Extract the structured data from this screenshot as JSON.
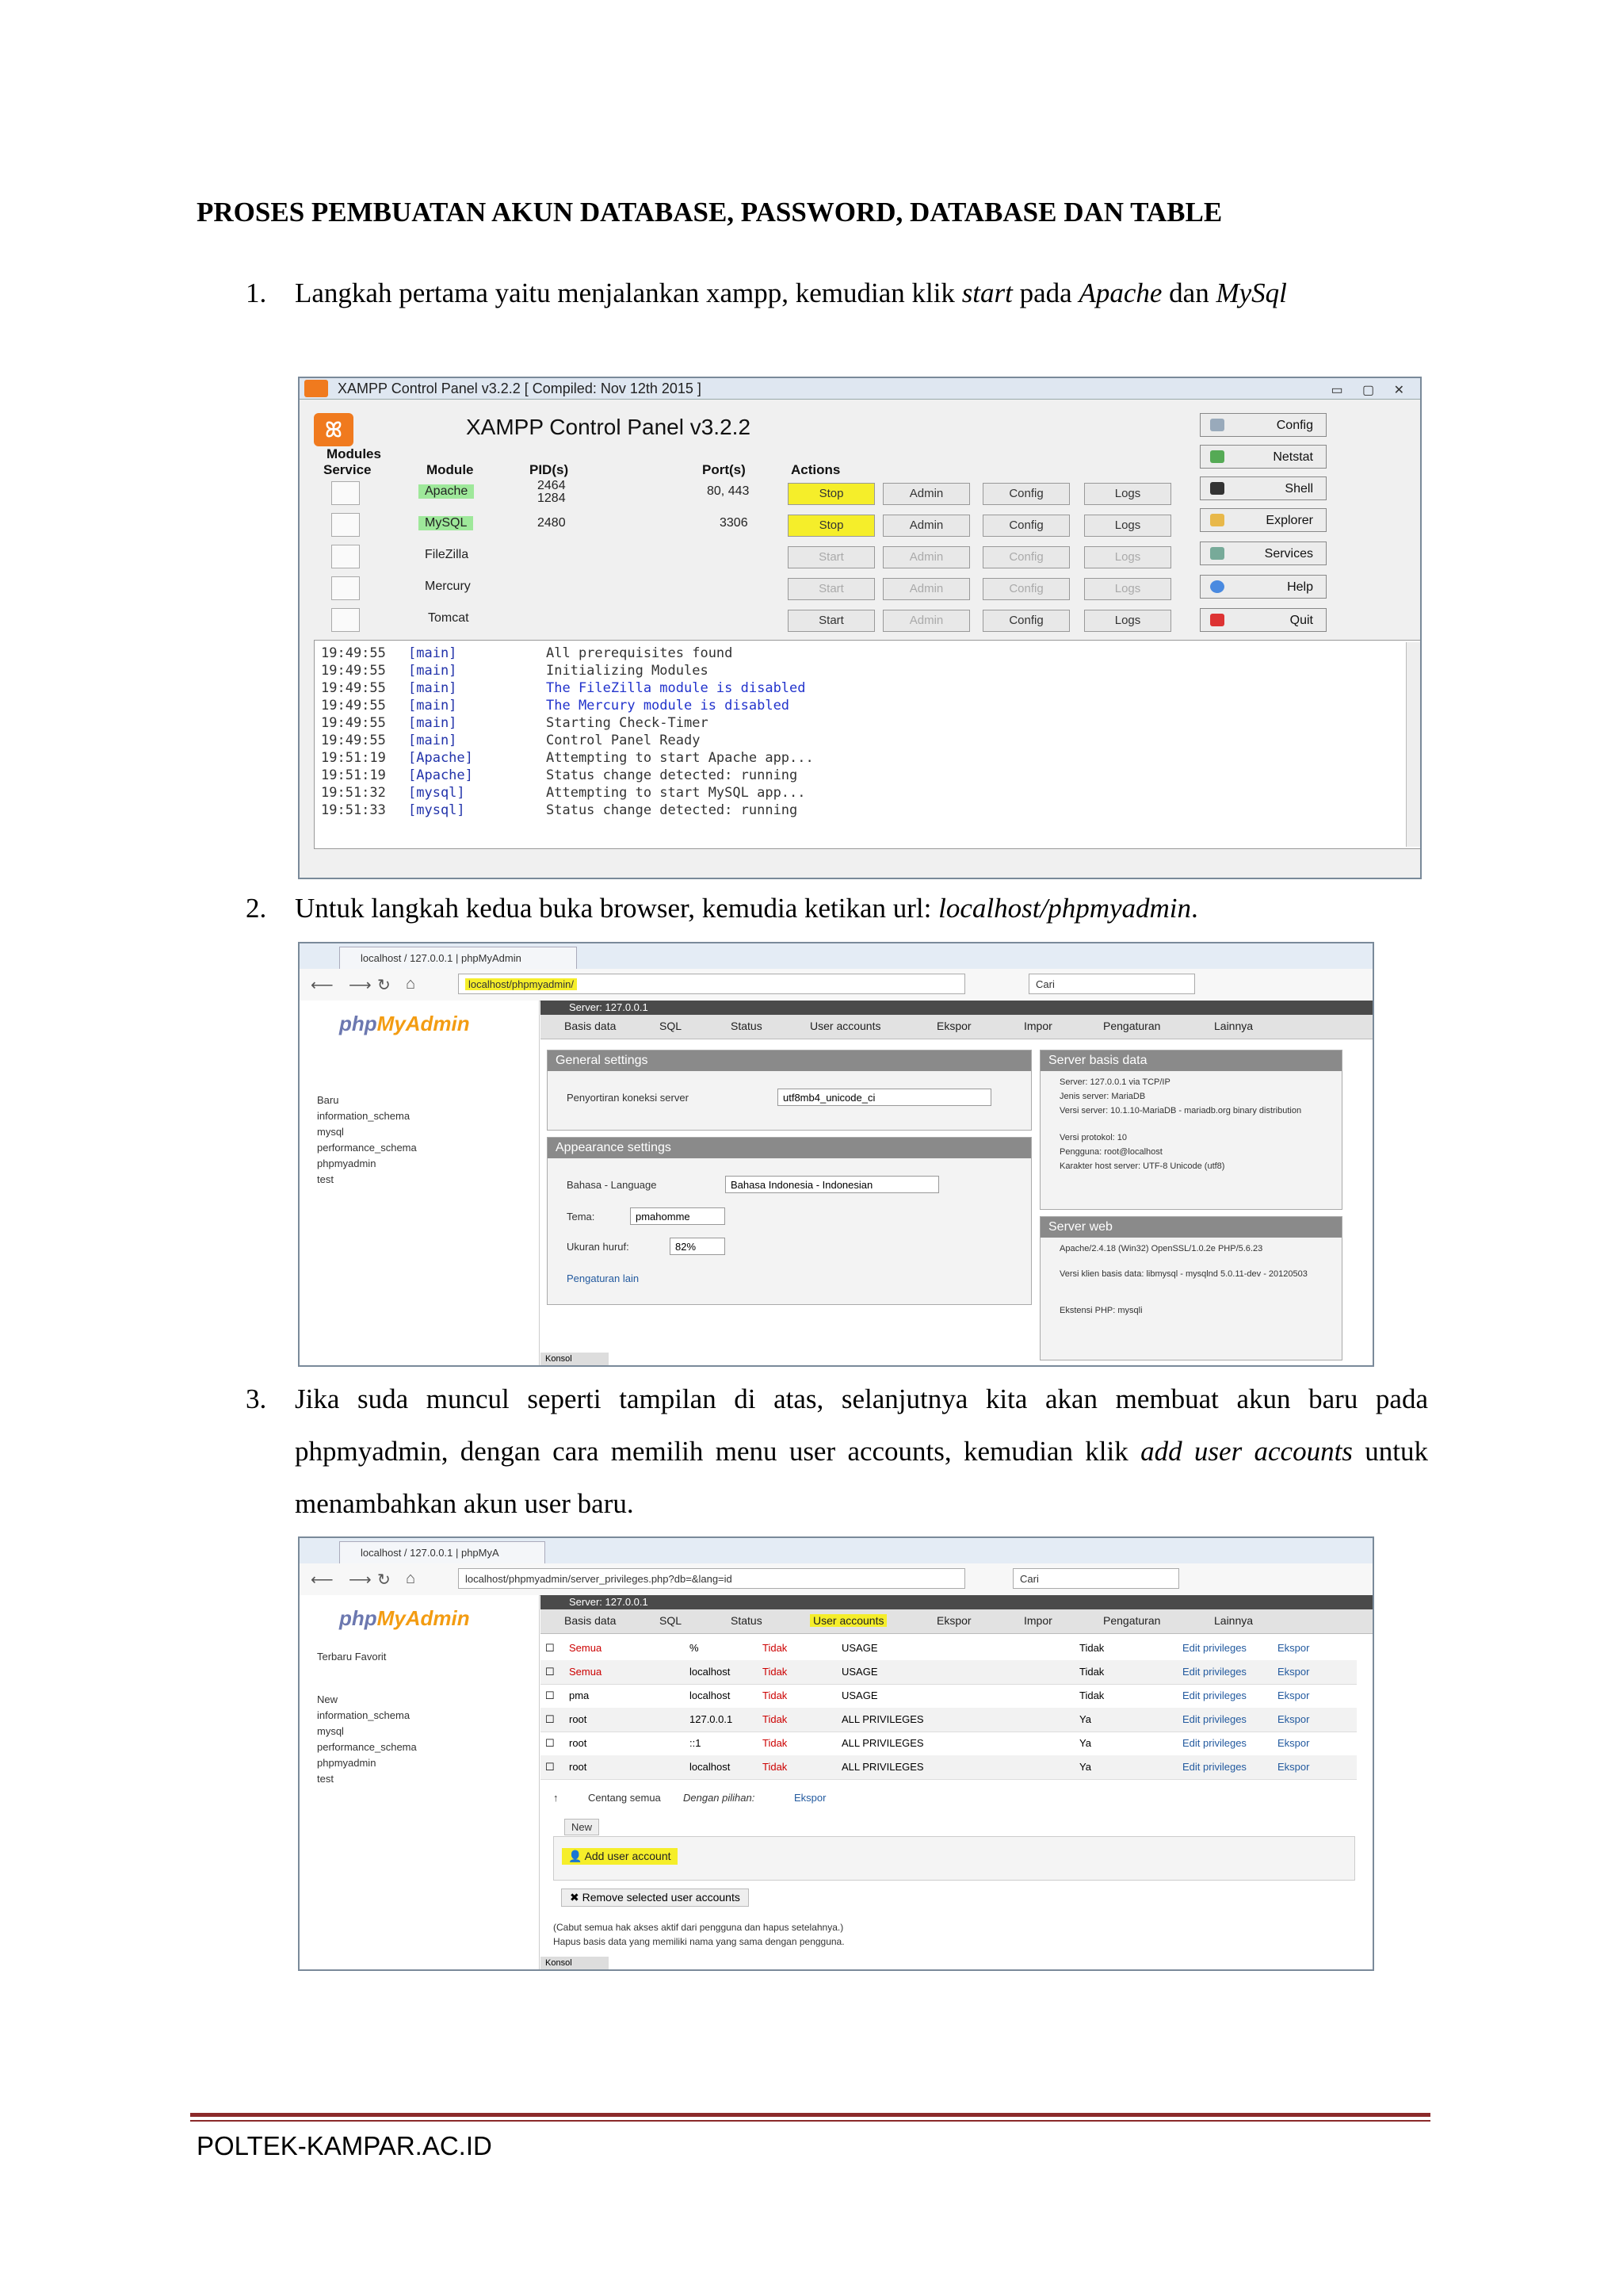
{
  "heading": "PROSES PEMBUATAN AKUN DATABASE, PASSWORD, DATABASE DAN TABLE",
  "steps": [
    {
      "num": "1.",
      "t1": "Langkah pertama yaitu menjalankan xampp, kemudian klik ",
      "i1": "start",
      "t2": " pada ",
      "i2": "Apache",
      "t3": " dan ",
      "i3": "MySql"
    },
    {
      "num": "2.",
      "t1": "Untuk langkah kedua buka browser, kemudia ketikan url: ",
      "i1": "localhost/phpmyadmin",
      "t2": "."
    },
    {
      "num": "3.",
      "t1": "Jika suda muncul seperti tampilan di atas, selanjutnya kita akan membuat akun baru pada phpmyadmin, dengan cara memilih menu user accounts, kemudian klik ",
      "i1": "add user accounts",
      "t2": " untuk menambahkan akun user baru."
    }
  ],
  "xampp": {
    "window_title": "XAMPP Control Panel v3.2.2   [ Compiled: Nov 12th 2015 ]",
    "title": "XAMPP Control Panel v3.2.2",
    "logo": "ꕤ",
    "modules_label": "Modules",
    "cols": {
      "service": "Service",
      "module": "Module",
      "pid": "PID(s)",
      "port": "Port(s)",
      "actions": "Actions"
    },
    "rows": [
      {
        "module": "Apache",
        "pid": "2464\n1284",
        "port": "80, 443",
        "action": "Stop"
      },
      {
        "module": "MySQL",
        "pid": "2480",
        "port": "3306",
        "action": "Stop"
      },
      {
        "module": "FileZilla",
        "pid": "",
        "port": "",
        "action": "Start"
      },
      {
        "module": "Mercury",
        "pid": "",
        "port": "",
        "action": "Start"
      },
      {
        "module": "Tomcat",
        "pid": "",
        "port": "",
        "action": "Start"
      }
    ],
    "btn_admin": "Admin",
    "btn_config": "Config",
    "btn_logs": "Logs",
    "side_buttons": [
      "Config",
      "Netstat",
      "Shell",
      "Explorer",
      "Services",
      "Help",
      "Quit"
    ],
    "log": [
      {
        "time": "19:49:55",
        "src": "[main]",
        "msg": "All prerequisites found"
      },
      {
        "time": "19:49:55",
        "src": "[main]",
        "msg": "Initializing Modules"
      },
      {
        "time": "19:49:55",
        "src": "[main]",
        "msg": "The FileZilla module is disabled"
      },
      {
        "time": "19:49:55",
        "src": "[main]",
        "msg": "The Mercury module is disabled"
      },
      {
        "time": "19:49:55",
        "src": "[main]",
        "msg": "Starting Check-Timer"
      },
      {
        "time": "19:49:55",
        "src": "[main]",
        "msg": "Control Panel Ready"
      },
      {
        "time": "19:51:19",
        "src": "[Apache]",
        "msg": "Attempting to start Apache app..."
      },
      {
        "time": "19:51:19",
        "src": "[Apache]",
        "msg": "Status change detected: running"
      },
      {
        "time": "19:51:32",
        "src": "[mysql]",
        "msg": "Attempting to start MySQL app..."
      },
      {
        "time": "19:51:33",
        "src": "[mysql]",
        "msg": "Status change detected: running"
      }
    ]
  },
  "browser1": {
    "tab": "localhost / 127.0.0.1 | phpMyAdmin",
    "url": "localhost/phpmyadmin/",
    "search": "Cari",
    "logo_a": "php",
    "logo_b": "MyAdmin",
    "tree": [
      "Baru",
      "information_schema",
      "mysql",
      "performance_schema",
      "phpmyadmin",
      "test"
    ],
    "bread": "Server: 127.0.0.1",
    "menu": [
      "Basis data",
      "SQL",
      "Status",
      "User accounts",
      "Ekspor",
      "Impor",
      "Pengaturan",
      "Lainnya"
    ],
    "gen_title": "General settings",
    "gen_label": "Penyortiran koneksi server",
    "gen_value": "utf8mb4_unicode_ci",
    "app_title": "Appearance settings",
    "app_lang": "Bahasa - Language",
    "app_lang_val": "Bahasa Indonesia - Indonesian",
    "app_theme": "Tema:",
    "app_theme_val": "pmahomme",
    "app_font": "Ukuran huruf:",
    "app_font_val": "82%",
    "app_more": "Pengaturan lain",
    "db_title": "Server basis data",
    "db_items": [
      "Server: 127.0.0.1 via TCP/IP",
      "Jenis server: MariaDB",
      "Versi server: 10.1.10-MariaDB - mariadb.org binary distribution",
      "Versi protokol: 10",
      "Pengguna: root@localhost",
      "Karakter host server: UTF-8 Unicode (utf8)"
    ],
    "web_title": "Server web",
    "web_items": [
      "Apache/2.4.18 (Win32) OpenSSL/1.0.2e PHP/5.6.23",
      "Versi klien basis data: libmysql - mysqlnd 5.0.11-dev - 20120503",
      "Ekstensi PHP: mysqli"
    ],
    "console": "Konsol"
  },
  "browser2": {
    "tab": "localhost / 127.0.0.1 | phpMyA",
    "url": "localhost/phpmyadmin/server_privileges.php?db=&lang=id",
    "search": "Cari",
    "logo_a": "php",
    "logo_b": "MyAdmin",
    "recent": "Terbaru   Favorit",
    "tree": [
      "New",
      "information_schema",
      "mysql",
      "performance_schema",
      "phpmyadmin",
      "test"
    ],
    "bread": "Server: 127.0.0.1",
    "menu": [
      "Basis data",
      "SQL",
      "Status",
      "User accounts",
      "Ekspor",
      "Impor",
      "Pengaturan",
      "Lainnya"
    ],
    "users": [
      {
        "user": "Semua",
        "host": "%",
        "pw": "Tidak",
        "priv": "USAGE",
        "grant": "Tidak"
      },
      {
        "user": "Semua",
        "host": "localhost",
        "pw": "Tidak",
        "priv": "USAGE",
        "grant": "Tidak"
      },
      {
        "user": "pma",
        "host": "localhost",
        "pw": "Tidak",
        "priv": "USAGE",
        "grant": "Tidak"
      },
      {
        "user": "root",
        "host": "127.0.0.1",
        "pw": "Tidak",
        "priv": "ALL PRIVILEGES",
        "grant": "Ya"
      },
      {
        "user": "root",
        "host": "::1",
        "pw": "Tidak",
        "priv": "ALL PRIVILEGES",
        "grant": "Ya"
      },
      {
        "user": "root",
        "host": "localhost",
        "pw": "Tidak",
        "priv": "ALL PRIVILEGES",
        "grant": "Ya"
      }
    ],
    "edit_priv": "Edit privileges",
    "export": "Ekspor",
    "check_all": "Centang semua",
    "with_selected": "Dengan pilihan:",
    "new_label": "New",
    "add_user": "Add user account",
    "remove": "Remove selected user accounts",
    "note": "(Cabut semua hak akses aktif dari pengguna dan hapus setelahnya.)",
    "note2": "Hapus basis data yang memiliki nama yang sama dengan pengguna.",
    "console": "Konsol"
  },
  "footer": "POLTEK-KAMPAR.AC.ID"
}
